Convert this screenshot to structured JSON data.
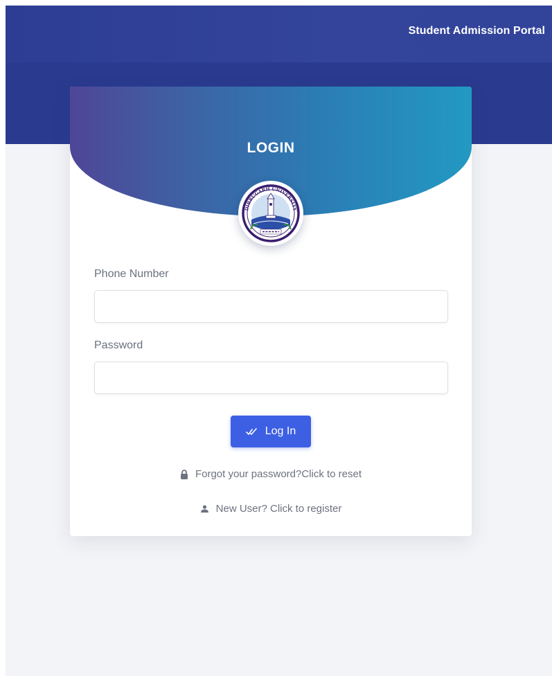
{
  "header": {
    "brand": "Student Admission Portal"
  },
  "login_card": {
    "title": "LOGIN",
    "logo_icon": "dibrugarh-university-seal-icon",
    "phone": {
      "label": "Phone Number",
      "value": "",
      "placeholder": ""
    },
    "password": {
      "label": "Password",
      "value": "",
      "placeholder": ""
    },
    "login_button": {
      "label": "Log In",
      "icon": "double-check-icon"
    },
    "forgot_link": {
      "label": "Forgot your password?Click to reset",
      "icon": "lock-icon"
    },
    "register_link": {
      "label": "New User? Click to register",
      "icon": "user-icon"
    }
  },
  "colors": {
    "nav_bg": "#2d3d94",
    "hero_bg": "#2a3b8f",
    "header_gradient_start": "#4f4697",
    "header_gradient_end": "#2299c2",
    "button_bg": "#3d5fe3",
    "page_bg": "#f3f4f7"
  }
}
